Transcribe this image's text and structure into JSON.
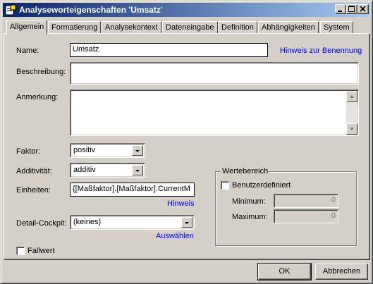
{
  "window": {
    "title": "Analyseworteigenschaften 'Umsatz'"
  },
  "tabs": [
    {
      "label": "Allgemein",
      "active": true
    },
    {
      "label": "Formatierung"
    },
    {
      "label": "Analysekontext"
    },
    {
      "label": "Dateneingabe"
    },
    {
      "label": "Definition"
    },
    {
      "label": "Abhängigkeiten"
    },
    {
      "label": "System"
    }
  ],
  "form": {
    "name_label": "Name:",
    "name_value": "Umsatz",
    "naming_hint_link": "Hinweis zur Benennung",
    "description_label": "Beschreibung:",
    "description_value": "",
    "note_label": "Anmerkung:",
    "note_value": "",
    "factor_label": "Faktor:",
    "factor_value": "positiv",
    "additivity_label": "Additivität:",
    "additivity_value": "additiv",
    "units_label": "Einheiten:",
    "units_value": "{[Maßfaktor].[Maßfaktor].CurrentM",
    "units_hint_link": "Hinweis",
    "cockpit_label": "Detail-Cockpit:",
    "cockpit_value": "(keines)",
    "cockpit_select_link": "Auswählen",
    "fallwert_label": "Fallwert",
    "fallwert_checked": false
  },
  "range": {
    "group_title": "Wertebereich",
    "custom_label": "Benutzerdefiniert",
    "custom_checked": false,
    "min_label": "Minimum:",
    "min_value": "0",
    "max_label": "Maximum:",
    "max_value": "0"
  },
  "footer": {
    "ok_label": "OK",
    "cancel_label": "Abbrechen"
  },
  "colors": {
    "titlebar_start": "#0a246a",
    "titlebar_end": "#a6caf0",
    "link": "#0000ff",
    "face": "#d4d0c8"
  },
  "icons": {
    "app": "properties-icon",
    "minimize": "minimize-icon",
    "maximize": "maximize-icon",
    "close": "close-icon"
  }
}
